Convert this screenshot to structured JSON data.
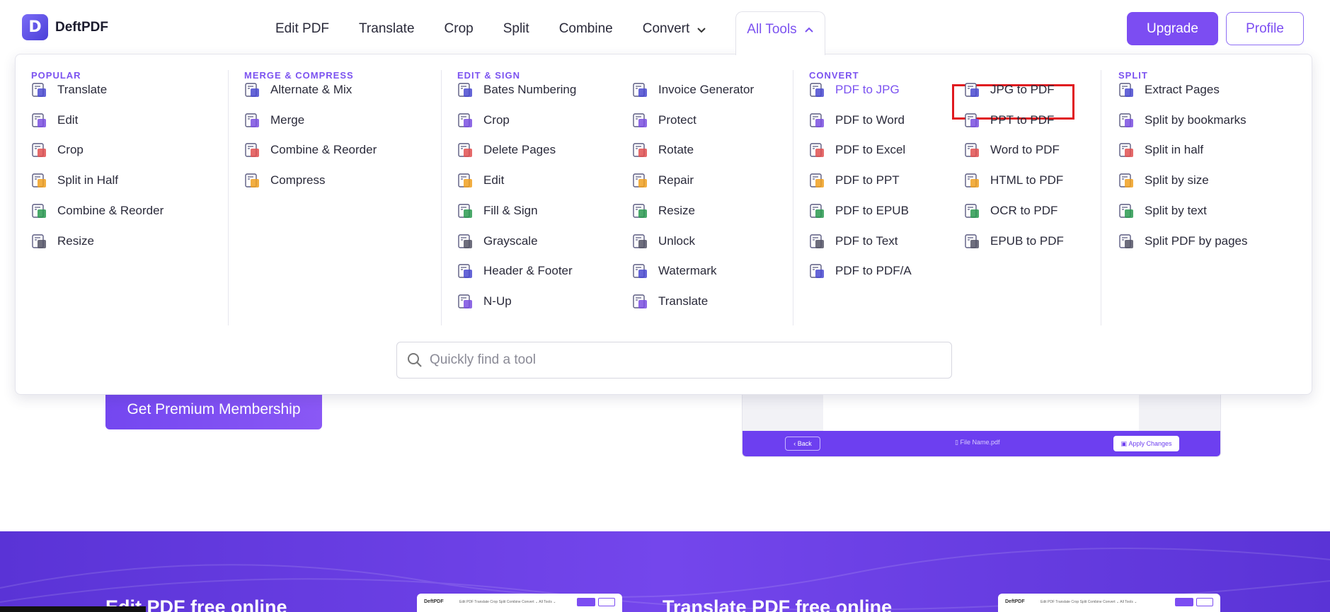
{
  "brand": {
    "name": "DeftPDF",
    "mark": "D"
  },
  "nav": {
    "items": [
      "Edit PDF",
      "Translate",
      "Crop",
      "Split",
      "Combine",
      "Convert"
    ],
    "all_tools": "All Tools"
  },
  "header": {
    "upgrade": "Upgrade",
    "profile": "Profile"
  },
  "menu": {
    "popular": {
      "title": "POPULAR",
      "items": [
        "Translate",
        "Edit",
        "Crop",
        "Split in Half",
        "Combine & Reorder",
        "Resize"
      ]
    },
    "merge": {
      "title": "MERGE & COMPRESS",
      "items": [
        "Alternate & Mix",
        "Merge",
        "Combine & Reorder",
        "Compress"
      ]
    },
    "edit": {
      "title": "EDIT & SIGN",
      "col1": [
        "Bates Numbering",
        "Crop",
        "Delete Pages",
        "Edit",
        "Fill & Sign",
        "Grayscale",
        "Header & Footer",
        "N-Up"
      ],
      "col2": [
        "Invoice Generator",
        "Protect",
        "Rotate",
        "Repair",
        "Resize",
        "Unlock",
        "Watermark",
        "Translate"
      ]
    },
    "convert": {
      "title": "CONVERT",
      "col1": [
        "PDF to JPG",
        "PDF to Word",
        "PDF to Excel",
        "PDF to PPT",
        "PDF to EPUB",
        "PDF to Text",
        "PDF to PDF/A"
      ],
      "col2": [
        "JPG to PDF",
        "PPT to PDF",
        "Word to PDF",
        "HTML to PDF",
        "OCR to PDF",
        "EPUB to PDF"
      ]
    },
    "split": {
      "title": "SPLIT",
      "items": [
        "Extract Pages",
        "Split by bookmarks",
        "Split in half",
        "Split by size",
        "Split by text",
        "Split PDF by pages"
      ]
    }
  },
  "search": {
    "placeholder": "Quickly find a tool"
  },
  "page": {
    "premium_button": "Get Premium Membership",
    "editor": {
      "back": "Back",
      "file": "File Name.pdf",
      "apply": "Apply Changes"
    },
    "band": {
      "title1": "Edit PDF free online",
      "title2": "Translate PDF free online"
    },
    "mini_nav": "Edit PDF   Translate   Crop   Split   Combine   Convert ⌄   All Tools ⌄"
  },
  "colors": {
    "accent": "#7b52f0",
    "highlight_box": "#e0191f"
  }
}
